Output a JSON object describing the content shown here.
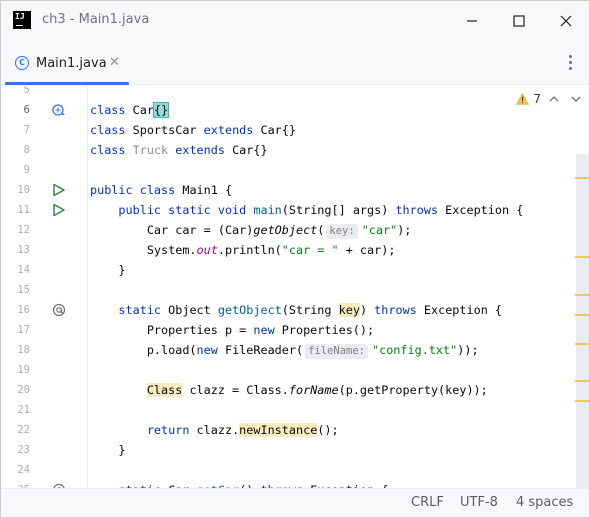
{
  "window": {
    "app_icon_text": "IJ",
    "title": "ch3 - Main1.java",
    "controls": [
      "minimize-icon",
      "maximize-icon",
      "close-icon"
    ]
  },
  "tabs": [
    {
      "label": "Main1.java",
      "icon": "java-class-icon",
      "close": "✕"
    }
  ],
  "inspections": {
    "warning_count": "7",
    "icon": "warning-icon"
  },
  "editor": {
    "lines": [
      {
        "num": "5",
        "text": ""
      },
      {
        "num": "6",
        "text": "class Car{}",
        "icon": "class-hierarchy-icon"
      },
      {
        "num": "7",
        "text": "class SportsCar extends Car{}"
      },
      {
        "num": "8",
        "text": "class Truck extends Car{}"
      },
      {
        "num": "9",
        "text": ""
      },
      {
        "num": "10",
        "text": "public class Main1 {",
        "icon": "run-icon"
      },
      {
        "num": "11",
        "text": "    public static void main(String[] args) throws Exception {",
        "icon": "run-icon"
      },
      {
        "num": "12",
        "text": "        Car car = (Car)getObject( key: \"car\");"
      },
      {
        "num": "13",
        "text": "        System.out.println(\"car = \" + car);"
      },
      {
        "num": "14",
        "text": "    }"
      },
      {
        "num": "15",
        "text": ""
      },
      {
        "num": "16",
        "text": "    static Object getObject(String key) throws Exception {",
        "icon": "annotation-icon"
      },
      {
        "num": "17",
        "text": "        Properties p = new Properties();"
      },
      {
        "num": "18",
        "text": "        p.load(new FileReader( fileName: \"config.txt\"));"
      },
      {
        "num": "19",
        "text": ""
      },
      {
        "num": "20",
        "text": "        Class clazz = Class.forName(p.getProperty(key));"
      },
      {
        "num": "21",
        "text": ""
      },
      {
        "num": "22",
        "text": "        return clazz.newInstance();"
      },
      {
        "num": "23",
        "text": "    }"
      },
      {
        "num": "24",
        "text": ""
      },
      {
        "num": "25",
        "text": "    static Car getCar() throws Exception {",
        "icon": "annotation-icon"
      }
    ],
    "inlay_hints": {
      "line12": "key:",
      "line18": "fileName:"
    },
    "strings": {
      "car": "\"car\"",
      "car_eq": "\"car = \"",
      "config": "\"config.txt\""
    }
  },
  "statusbar": {
    "line_separator": "CRLF",
    "encoding": "UTF-8",
    "indent": "4 spaces"
  },
  "colors": {
    "accent": "#3574f0",
    "keyword": "#0033b3",
    "string": "#067d17",
    "method": "#00627a",
    "warning_marker": "#f2c55c"
  }
}
